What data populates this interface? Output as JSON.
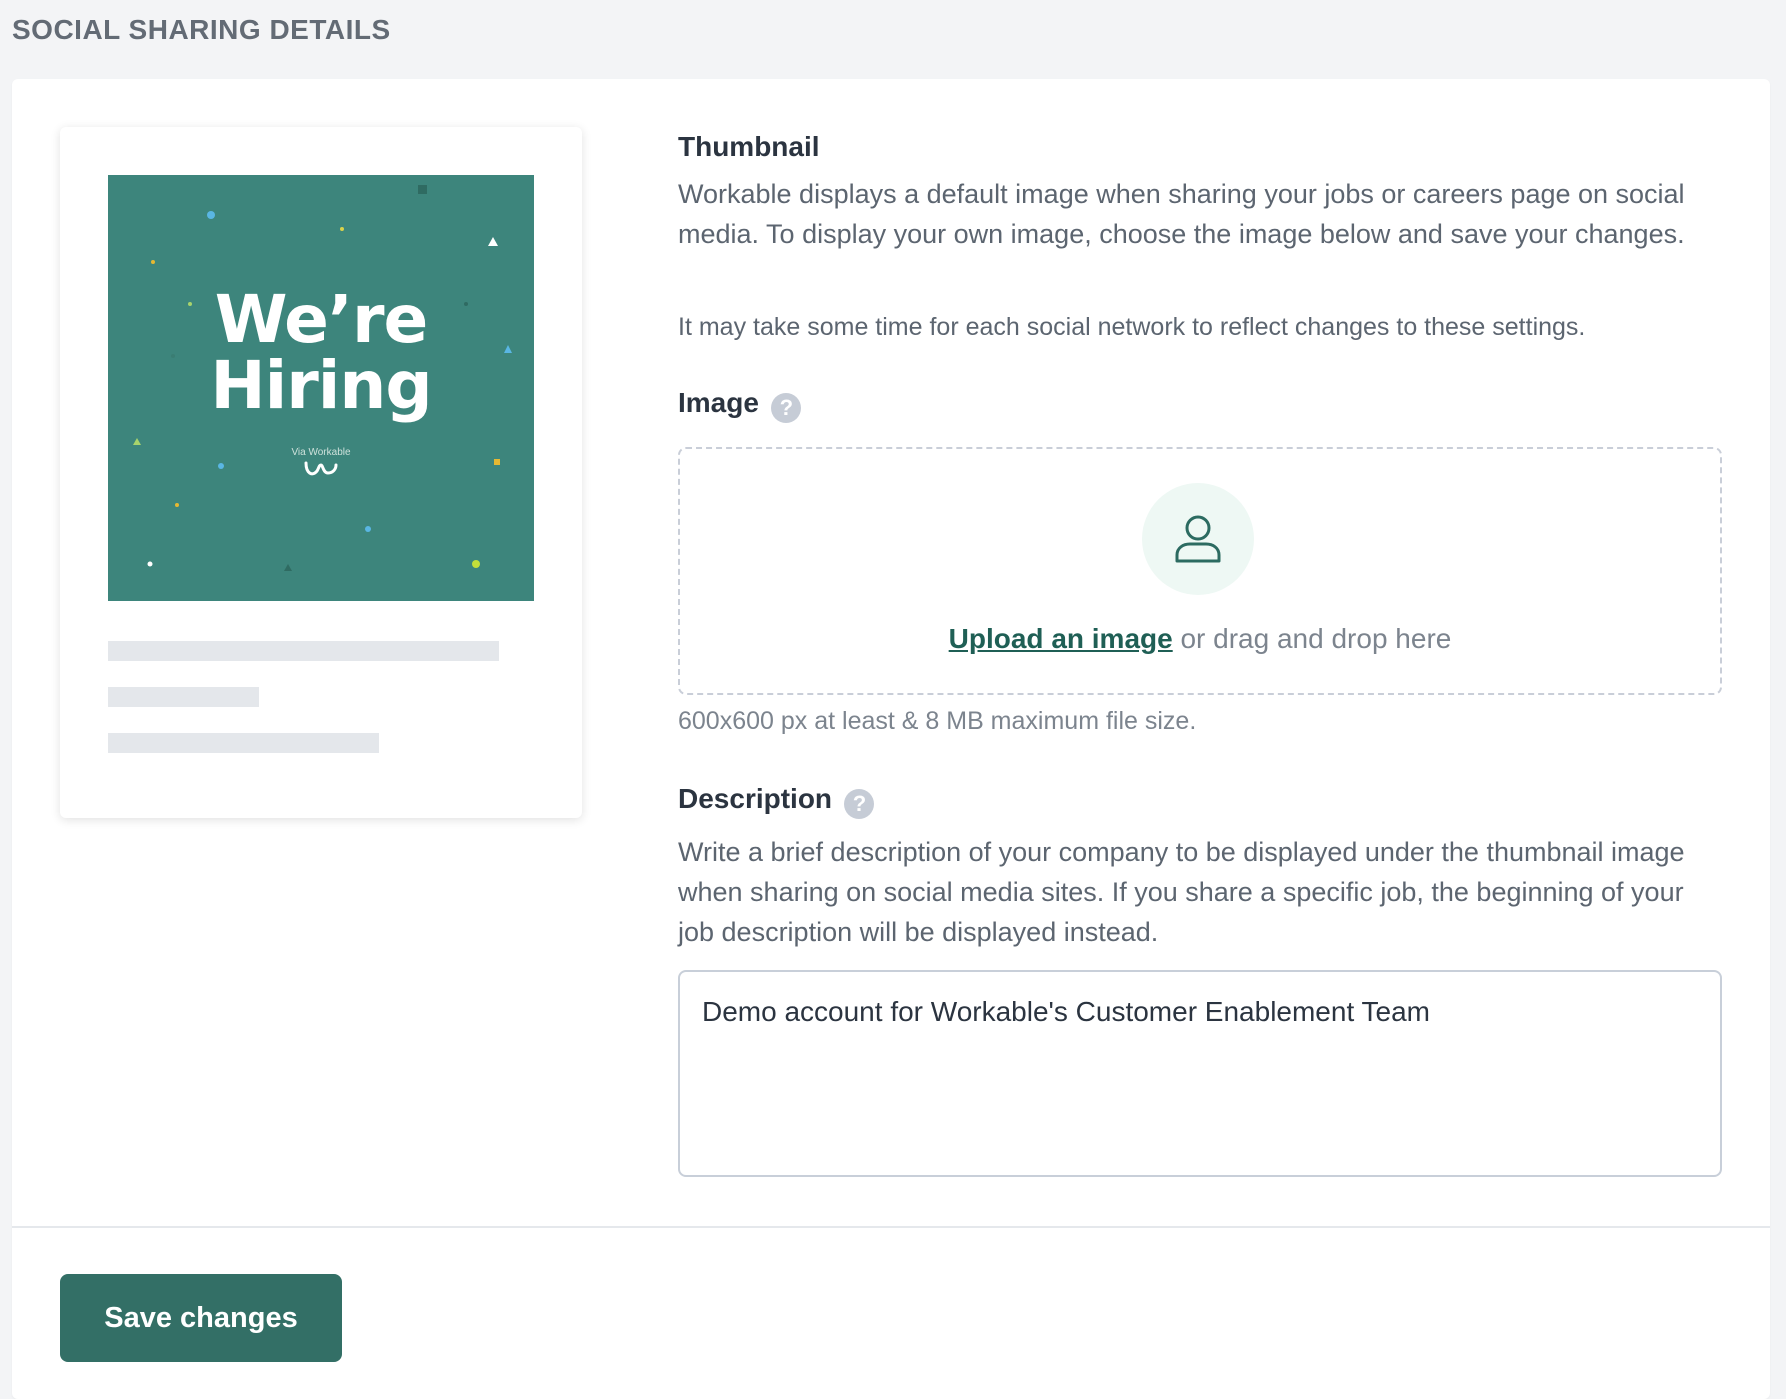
{
  "page": {
    "section_title": "SOCIAL SHARING DETAILS"
  },
  "preview": {
    "hiring_text_line1": "We’re",
    "hiring_text_line2": "Hiring",
    "via_text": "Via Workable",
    "image_bg_color": "#3d857c"
  },
  "thumbnail": {
    "heading": "Thumbnail",
    "description": "Workable displays a default image when sharing your jobs or careers page on social media. To display your own image, choose the image below and save your changes.",
    "note": "It may take some time for each social network to reflect changes to these settings."
  },
  "image": {
    "label": "Image",
    "help_icon": "question-icon",
    "upload_link": "Upload an image",
    "upload_rest": " or drag and drop here",
    "hint": "600x600 px at least & 8 MB maximum file size.",
    "avatar_icon": "user-icon"
  },
  "description": {
    "label": "Description",
    "help_icon": "question-icon",
    "explanation": "Write a brief description of your company to be displayed under the thumbnail image when sharing on social media sites. If you share a specific job, the beginning of your job description will be displayed instead.",
    "value": "Demo account for Workable's Customer Enablement Team"
  },
  "actions": {
    "save_label": "Save changes"
  },
  "colors": {
    "accent": "#336f66",
    "link": "#1f5f55"
  }
}
